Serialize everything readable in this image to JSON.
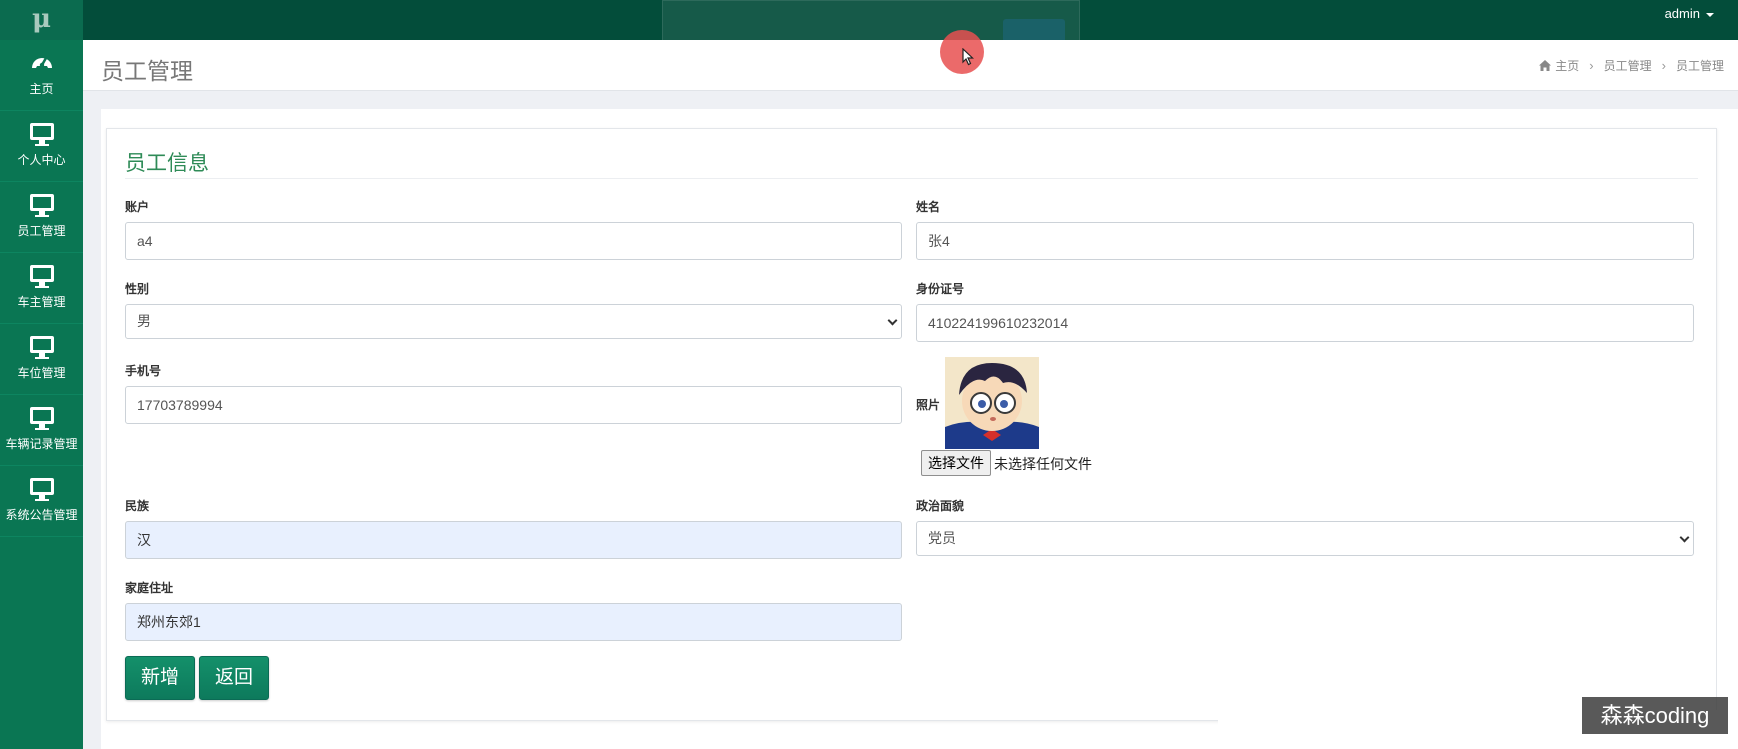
{
  "app": {
    "logo": "μ",
    "user": "admin"
  },
  "sidebar": {
    "items": [
      {
        "label": "主页",
        "icon": "dashboard-icon"
      },
      {
        "label": "个人中心",
        "icon": "monitor-icon"
      },
      {
        "label": "员工管理",
        "icon": "monitor-icon"
      },
      {
        "label": "车主管理",
        "icon": "monitor-icon"
      },
      {
        "label": "车位管理",
        "icon": "monitor-icon"
      },
      {
        "label": "车辆记录管理",
        "icon": "monitor-icon"
      },
      {
        "label": "系统公告管理",
        "icon": "monitor-icon"
      }
    ]
  },
  "header": {
    "title": "员工管理",
    "breadcrumb": [
      "主页",
      "员工管理",
      "员工管理"
    ]
  },
  "form": {
    "title": "员工信息",
    "account": {
      "label": "账户",
      "value": "a4"
    },
    "name": {
      "label": "姓名",
      "value": "张4"
    },
    "gender": {
      "label": "性别",
      "value": "男"
    },
    "id_number": {
      "label": "身份证号",
      "value": "410224199610232014"
    },
    "phone": {
      "label": "手机号",
      "value": "17703789994"
    },
    "photo": {
      "label": "照片",
      "file_button": "选择文件",
      "file_status": "未选择任何文件"
    },
    "ethnicity": {
      "label": "民族",
      "value": "汉"
    },
    "political_status": {
      "label": "政治面貌",
      "value": "党员"
    },
    "address": {
      "label": "家庭住址",
      "value": "郑州东郊1"
    },
    "buttons": {
      "add": "新增",
      "back": "返回"
    }
  },
  "watermark": "森森coding",
  "colors": {
    "topbar": "#034d3a",
    "sidebar": "#0a7653",
    "accent": "#2e8b57",
    "button": "#0d7a5c"
  }
}
